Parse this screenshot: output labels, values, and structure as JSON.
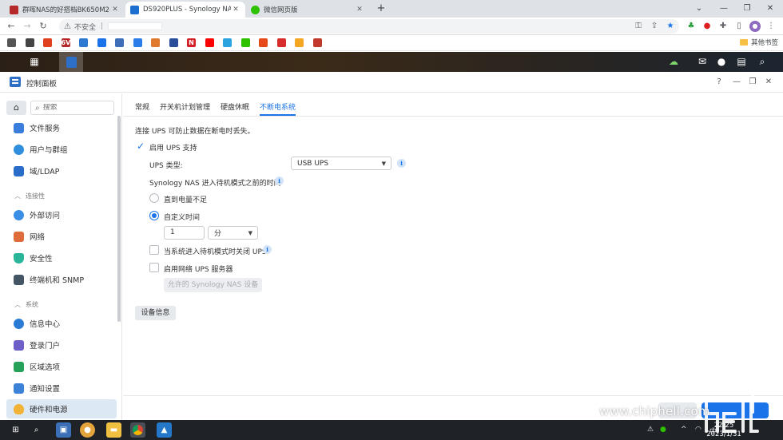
{
  "browser": {
    "tabs": [
      {
        "title": "群晖NAS的好搭档BK650M2-CH",
        "color": "#b5292b",
        "active": false
      },
      {
        "title": "DS920PLUS - Synology NAS",
        "color": "#1d6fd0",
        "active": true
      },
      {
        "title": "微信网页版",
        "color": "#2dc100",
        "active": false
      }
    ],
    "new_tab": "+",
    "address": {
      "security_label": "不安全",
      "separator": "|"
    },
    "bookmarks_other": "其他书签",
    "bookmark_icons": [
      {
        "label": "",
        "color": "#555555"
      },
      {
        "label": "",
        "color": "#444444"
      },
      {
        "label": "",
        "color": "#e0401e"
      },
      {
        "label": "6V",
        "color": "#b52a2a"
      },
      {
        "label": "",
        "color": "#2d78d0"
      },
      {
        "label": "",
        "color": "#1a73e8"
      },
      {
        "label": "",
        "color": "#3c6fb8"
      },
      {
        "label": "",
        "color": "#2b7de9"
      },
      {
        "label": "",
        "color": "#e07a2d"
      },
      {
        "label": "",
        "color": "#2a4f9a"
      },
      {
        "label": "N",
        "color": "#d41f26"
      },
      {
        "label": "",
        "color": "#ff0000"
      },
      {
        "label": "",
        "color": "#2aa3df"
      },
      {
        "label": "",
        "color": "#2dc100"
      },
      {
        "label": "",
        "color": "#e64a19"
      },
      {
        "label": "",
        "color": "#d82d2d"
      },
      {
        "label": "",
        "color": "#f5a623"
      },
      {
        "label": "",
        "color": "#c0392b"
      }
    ]
  },
  "window": {
    "title": "控制面板",
    "help": "?"
  },
  "sidebar": {
    "search_placeholder": "搜索",
    "items": [
      {
        "label": "文件服务",
        "color": "#3b7ddd"
      },
      {
        "label": "用户与群组",
        "color": "#2f8fdd"
      },
      {
        "label": "域/LDAP",
        "color": "#2a6cc9"
      }
    ],
    "group_connectivity": "连接性",
    "connectivity_items": [
      {
        "label": "外部访问",
        "color": "#3a8ee6"
      },
      {
        "label": "网络",
        "color": "#e06b3a"
      },
      {
        "label": "安全性",
        "color": "#28b59a"
      },
      {
        "label": "终端机和 SNMP",
        "color": "#445566"
      }
    ],
    "group_system": "系统",
    "system_items": [
      {
        "label": "信息中心",
        "color": "#2a7bd6"
      },
      {
        "label": "登录门户",
        "color": "#6c5fc7"
      },
      {
        "label": "区域选项",
        "color": "#27a05a"
      },
      {
        "label": "通知设置",
        "color": "#3c82d8"
      },
      {
        "label": "硬件和电源",
        "color": "#f2b233",
        "selected": true
      }
    ]
  },
  "main": {
    "tabs": [
      "常规",
      "开关机计划管理",
      "硬盘休眠",
      "不断电系统"
    ],
    "active_tab": "不断电系统",
    "intro": "连接 UPS 可防止数据在断电时丢失。",
    "enable_ups": "启用 UPS 支持",
    "ups_type_label": "UPS 类型:",
    "ups_type_value": "USB UPS",
    "standby_label": "Synology NAS 进入待机模式之前的时间",
    "option_until_low": "直到电量不足",
    "option_custom": "自定义时间",
    "custom_value": "1",
    "custom_unit": "分",
    "shutdown_ups": "当系统进入待机模式时关闭 UPS",
    "enable_network_ups": "启用网络 UPS 服务器",
    "allowed_devices_btn": "允许的 Synology NAS 设备",
    "device_info_btn": "设备信息"
  },
  "taskbar": {
    "time": "22:25",
    "date": "2023/1/31",
    "ime": "中"
  },
  "watermark": {
    "text": "www.chiphell.com",
    "logo": "chip hell"
  }
}
